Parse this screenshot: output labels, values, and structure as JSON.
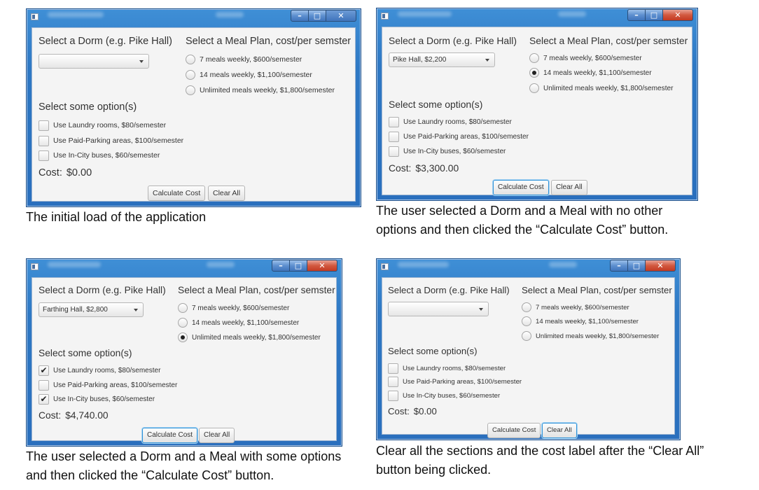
{
  "labels": {
    "dorm_prompt": "Select a Dorm (e.g. Pike Hall)",
    "meal_prompt": "Select a Meal Plan, cost/per semster",
    "options_prompt": "Select some option(s)",
    "cost_prefix": "Cost:",
    "calc_button": "Calculate Cost",
    "clear_button": "Clear All"
  },
  "meal_options": [
    "7 meals weekly, $600/semester",
    "14 meals weekly, $1,100/semester",
    "Unlimited meals weekly, $1,800/semester"
  ],
  "extra_options": [
    "Use Laundry rooms, $80/semester",
    "Use Paid-Parking areas, $100/semester",
    "Use In-City buses, $60/semester"
  ],
  "panels": [
    {
      "dorm_value": "",
      "meal_selected": null,
      "options_checked": [
        false,
        false,
        false
      ],
      "cost": "$0.00",
      "focused_button": "none",
      "caption": "The initial load of the application",
      "title_active": true
    },
    {
      "dorm_value": "Pike Hall, $2,200",
      "meal_selected": 1,
      "options_checked": [
        false,
        false,
        false
      ],
      "cost": "$3,300.00",
      "focused_button": "calc",
      "caption": "The user selected a Dorm and a Meal with no other options and then clicked the “Calculate Cost” button.",
      "title_active": false
    },
    {
      "dorm_value": "Farthing Hall, $2,800",
      "meal_selected": 2,
      "options_checked": [
        true,
        false,
        true
      ],
      "cost": "$4,740.00",
      "focused_button": "calc",
      "caption": "The user selected a Dorm and a Meal with some options and then clicked the “Calculate Cost” button.",
      "title_active": false
    },
    {
      "dorm_value": "",
      "meal_selected": null,
      "options_checked": [
        false,
        false,
        false
      ],
      "cost": "$0.00",
      "focused_button": "clear",
      "caption": "Clear all the sections and the cost label after the “Clear All” button being clicked.",
      "title_active": false
    }
  ],
  "icons": {
    "app": "app-window-icon",
    "minimize": "minimize-icon",
    "maximize": "maximize-icon",
    "close": "close-icon",
    "dropdown": "chevron-down-icon",
    "check": "checkmark-icon"
  }
}
